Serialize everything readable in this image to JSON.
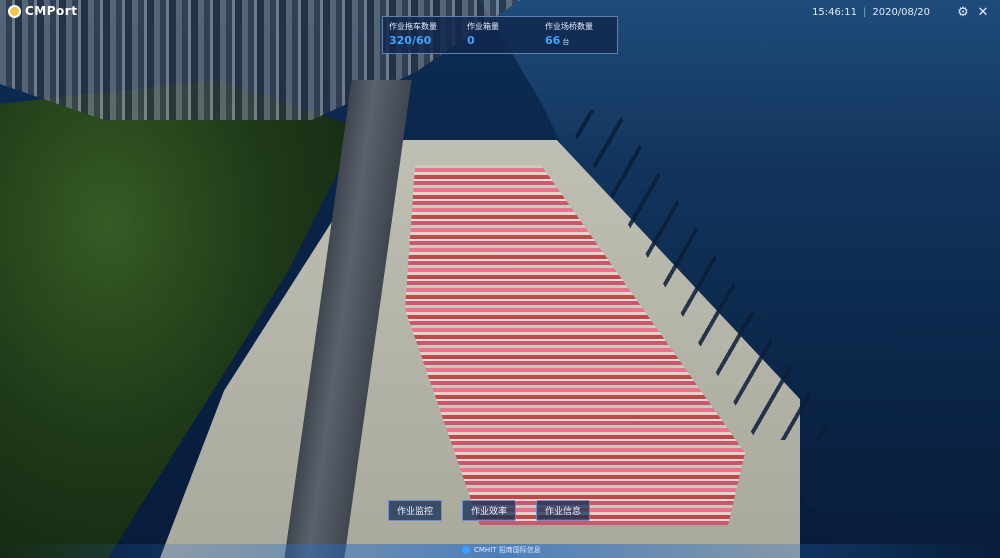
{
  "app": {
    "logo_text": "CMPort"
  },
  "stats": [
    {
      "label": "作业拖车数量",
      "value": "320/60",
      "unit": ""
    },
    {
      "label": "作业箱量",
      "value": "0",
      "unit": ""
    },
    {
      "label": "作业场桥数量",
      "value": "66",
      "unit": "台"
    }
  ],
  "clock": {
    "time": "15:46:11",
    "date": "2020/08/20"
  },
  "nav": {
    "monitor_label": "作业监控",
    "efficiency_label": "作业效率",
    "info_label": "作业信息"
  },
  "footer": {
    "brand_text": "CMHIT 招商国际信息"
  },
  "icons": {
    "settings": "gear-icon",
    "tools": "tools-icon",
    "logo": "logo-icon"
  },
  "colors": {
    "accent": "#43a3ff",
    "panel": "#12284e"
  }
}
